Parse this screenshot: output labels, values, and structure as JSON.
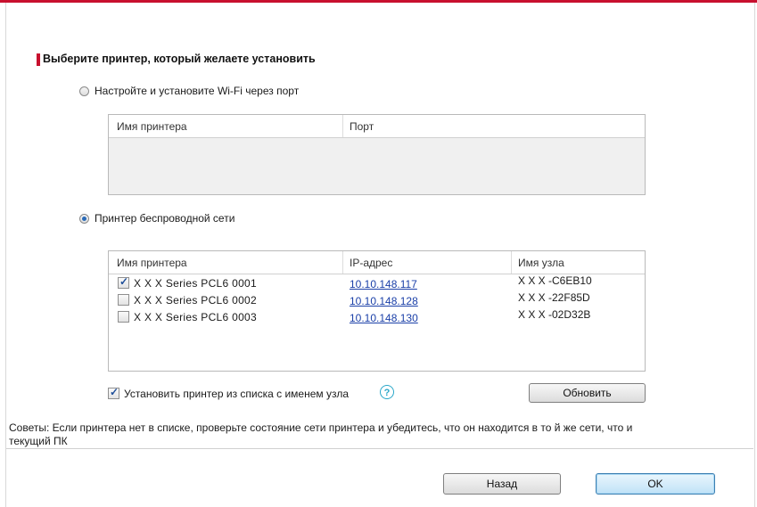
{
  "title": "Выберите принтер, который желаете установить",
  "option_wifi_port": {
    "label": "Настройте и установите Wi-Fi через порт",
    "selected": false
  },
  "table_port": {
    "headers": [
      "Имя принтера",
      "Порт"
    ],
    "rows": []
  },
  "option_wireless": {
    "label": "Принтер беспроводной сети",
    "selected": true
  },
  "table_wireless": {
    "headers": [
      "Имя принтера",
      "IP-адрес",
      "Имя узла"
    ],
    "rows": [
      {
        "checked": true,
        "name": "X X X  Series PCL6 0001",
        "ip": "10.10.148.117",
        "host": "X X X -C6EB10"
      },
      {
        "checked": false,
        "name": "X X X  Series PCL6 0002",
        "ip": "10.10.148.128",
        "host": "X X X -22F85D"
      },
      {
        "checked": false,
        "name": "X X X  Series PCL6 0003",
        "ip": "10.10.148.130",
        "host": "X X X -02D32B"
      }
    ]
  },
  "install_by_hostname": {
    "label": "Установить принтер из списка с именем узла",
    "checked": true
  },
  "help_symbol": "?",
  "refresh_label": "Обновить",
  "tip": "Советы: Если принтера нет в списке, проверьте состояние сети принтера и убедитесь, что он находится в то й же сети, что и текущий ПК",
  "back_label": "Назад",
  "ok_label": "OK",
  "colors": {
    "accent_red": "#c8102e",
    "link_blue": "#1a3fa8",
    "help_blue": "#2aa7c9"
  },
  "icons": {
    "radio": "radio-icon",
    "checkbox": "checkbox-icon",
    "help": "question-circle-icon"
  }
}
